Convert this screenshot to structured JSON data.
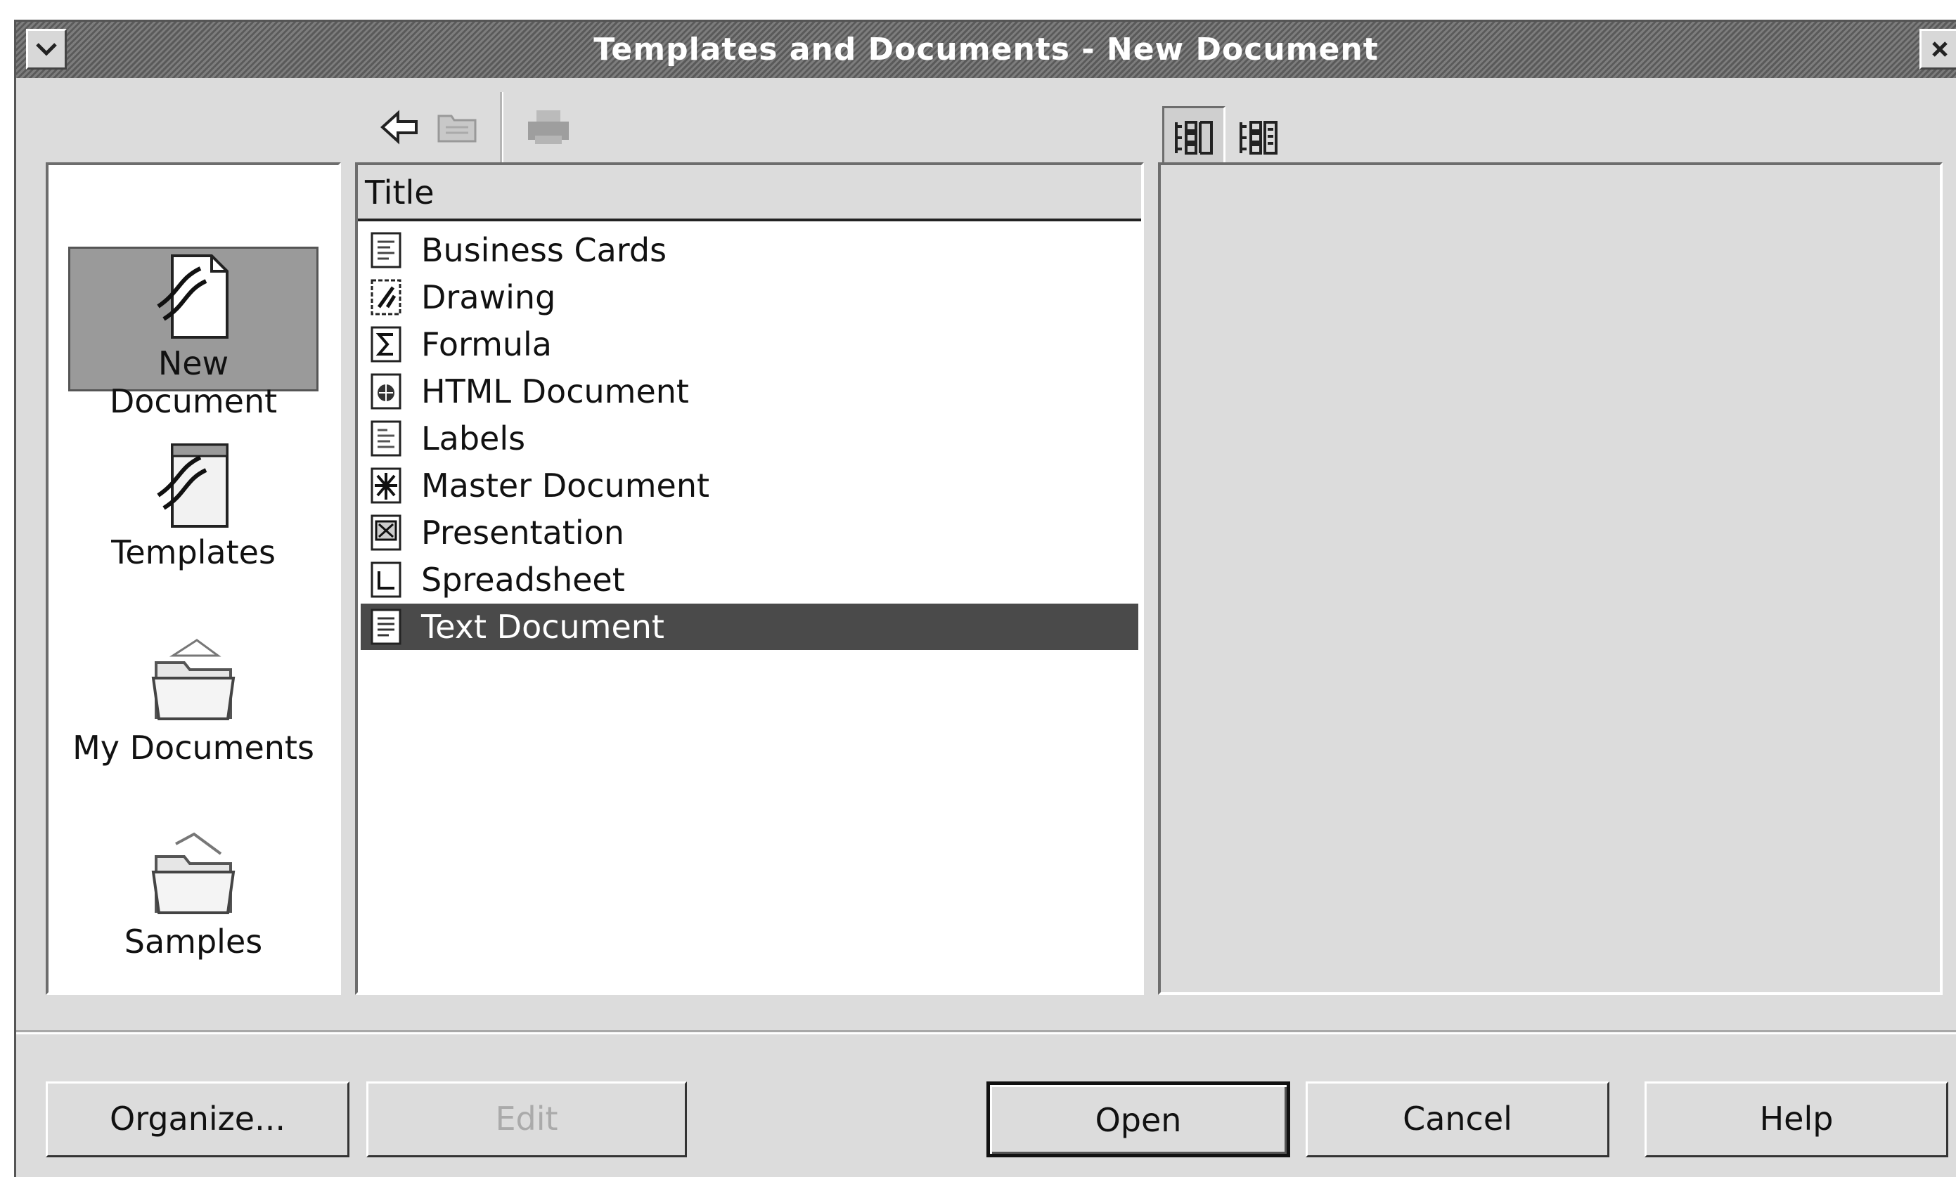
{
  "window": {
    "title": "Templates and Documents - New Document"
  },
  "titlebar": {
    "menu_icon": "chevron-down-icon",
    "close_icon": "close-icon"
  },
  "toolbar": {
    "back_icon": "back-arrow-icon",
    "folder_up_icon": "folder-up-icon",
    "print_icon": "print-icon",
    "view_document_icon": "document-view-icon",
    "view_properties_icon": "properties-view-icon"
  },
  "categories": [
    {
      "label": "New Document",
      "icon": "new-document-icon",
      "selected": true
    },
    {
      "label": "Templates",
      "icon": "templates-icon",
      "selected": false
    },
    {
      "label": "My Documents",
      "icon": "my-documents-icon",
      "selected": false
    },
    {
      "label": "Samples",
      "icon": "samples-icon",
      "selected": false
    }
  ],
  "list": {
    "header": "Title",
    "items": [
      {
        "label": "Business Cards",
        "icon": "business-cards-icon"
      },
      {
        "label": "Drawing",
        "icon": "drawing-icon"
      },
      {
        "label": "Formula",
        "icon": "formula-icon"
      },
      {
        "label": "HTML Document",
        "icon": "html-document-icon"
      },
      {
        "label": "Labels",
        "icon": "labels-icon"
      },
      {
        "label": "Master Document",
        "icon": "master-document-icon"
      },
      {
        "label": "Presentation",
        "icon": "presentation-icon"
      },
      {
        "label": "Spreadsheet",
        "icon": "spreadsheet-icon"
      },
      {
        "label": "Text Document",
        "icon": "text-document-icon",
        "selected": true
      }
    ]
  },
  "buttons": {
    "organize": "Organize...",
    "edit": "Edit",
    "open": "Open",
    "cancel": "Cancel",
    "help": "Help"
  },
  "colors": {
    "selection": "#4a4a4a",
    "titlebar": "#6b6b6b",
    "dialog": "#dcdcdc"
  }
}
